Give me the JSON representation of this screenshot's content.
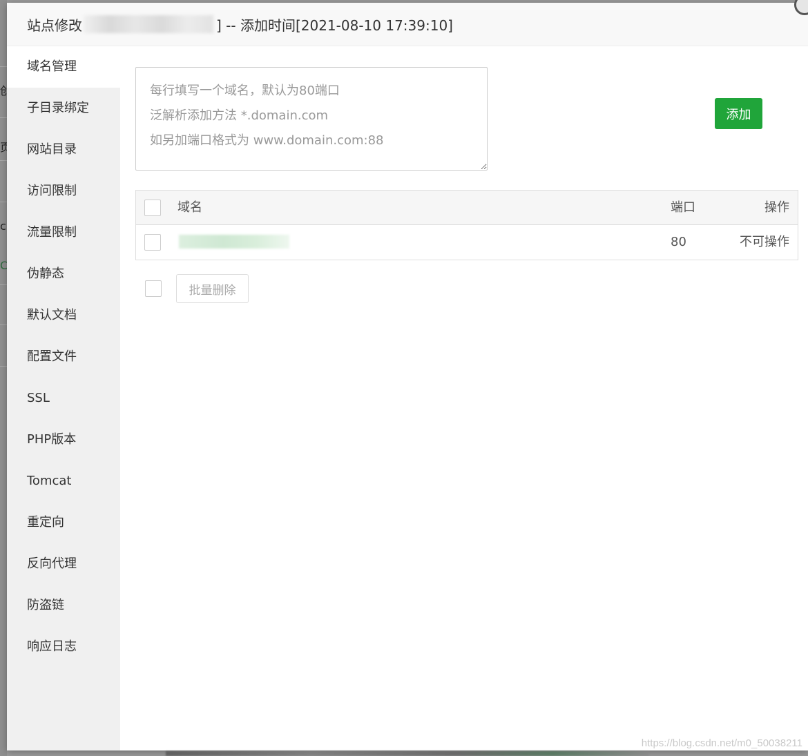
{
  "dialog": {
    "title_prefix": "站点修改",
    "title_suffix": "] -- 添加时间[2021-08-10 17:39:10]"
  },
  "background": {
    "fragments": [
      "创",
      "页",
      "c",
      "Ca"
    ]
  },
  "sidebar": {
    "items": [
      {
        "label": "域名管理",
        "active": true
      },
      {
        "label": "子目录绑定"
      },
      {
        "label": "网站目录"
      },
      {
        "label": "访问限制"
      },
      {
        "label": "流量限制"
      },
      {
        "label": "伪静态"
      },
      {
        "label": "默认文档"
      },
      {
        "label": "配置文件"
      },
      {
        "label": "SSL"
      },
      {
        "label": "PHP版本"
      },
      {
        "label": "Tomcat"
      },
      {
        "label": "重定向"
      },
      {
        "label": "反向代理"
      },
      {
        "label": "防盗链"
      },
      {
        "label": "响应日志"
      }
    ]
  },
  "domain_form": {
    "placeholder": "每行填写一个域名，默认为80端口\n泛解析添加方法 *.domain.com\n如另加端口格式为 www.domain.com:88",
    "add_label": "添加"
  },
  "table": {
    "headers": {
      "name": "域名",
      "port": "端口",
      "action": "操作"
    },
    "rows": [
      {
        "port": "80",
        "action": "不可操作"
      }
    ]
  },
  "bulk": {
    "delete_label": "批量删除"
  },
  "watermark": "https://blog.csdn.net/m0_50038211",
  "colors": {
    "accent": "#20a53a",
    "sidebar_bg": "#f0f0f0",
    "header_bg": "#f8f8f8"
  }
}
